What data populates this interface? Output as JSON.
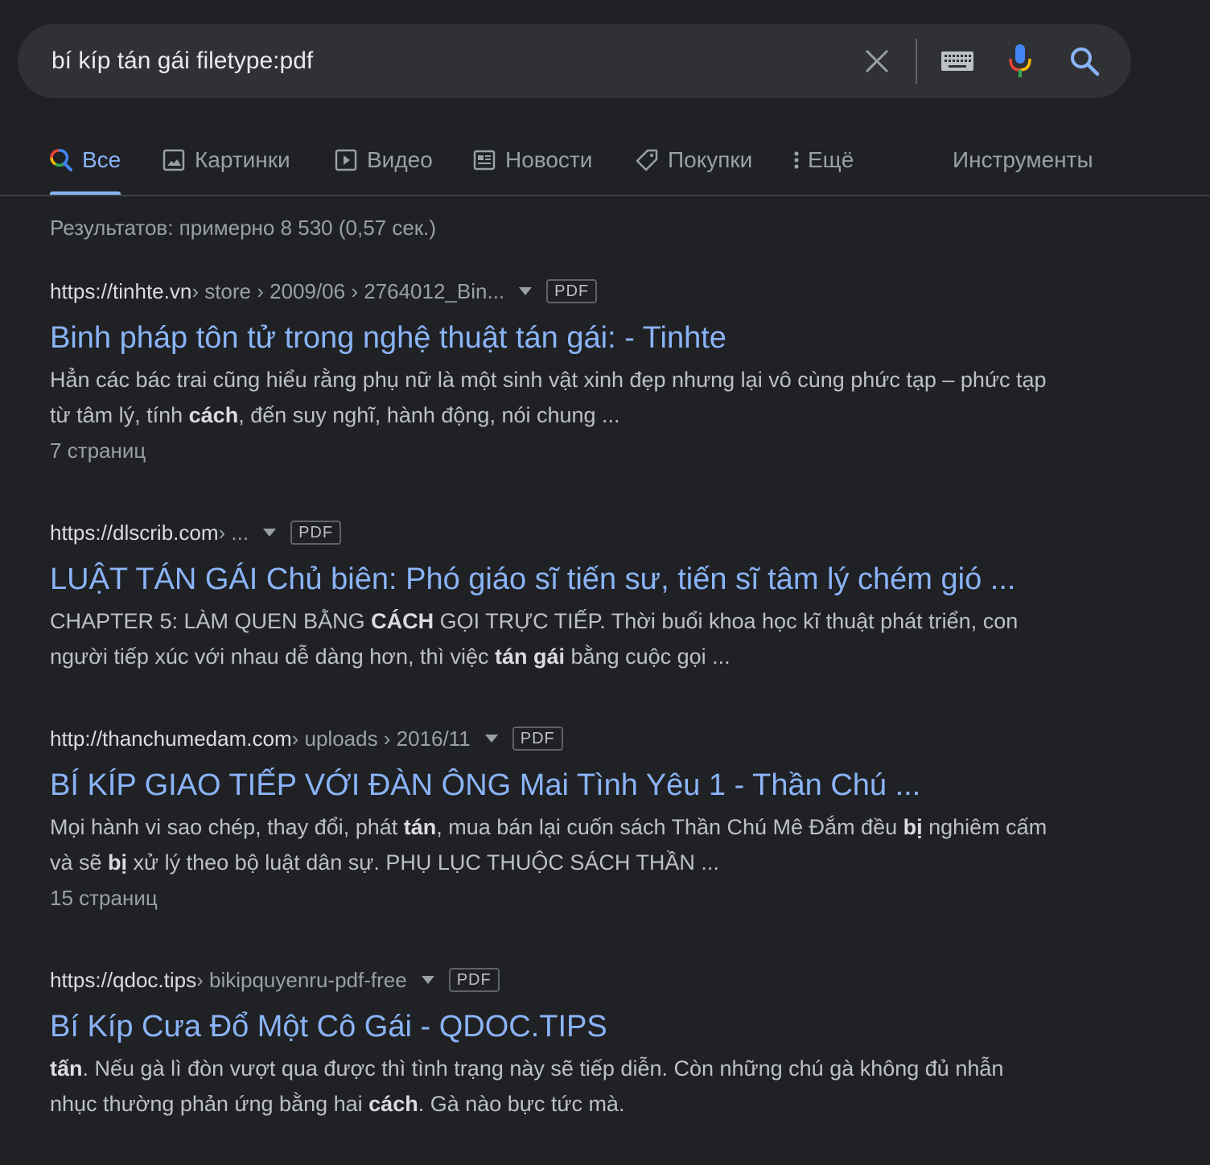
{
  "search": {
    "query": "bí kíp tán gái filetype:pdf",
    "icons": [
      "close-icon",
      "keyboard-icon",
      "mic-icon",
      "search-icon"
    ]
  },
  "tabs": [
    {
      "label": "Все",
      "icon": "google-search-icon",
      "active": true
    },
    {
      "label": "Картинки",
      "icon": "image-icon"
    },
    {
      "label": "Видео",
      "icon": "video-play-icon"
    },
    {
      "label": "Новости",
      "icon": "news-icon"
    },
    {
      "label": "Покупки",
      "icon": "tag-icon"
    },
    {
      "label": "Ещё",
      "icon": "more-vert-icon"
    }
  ],
  "tools_label": "Инструменты",
  "stats": "Результатов: примерно 8 530 (0,57 сек.)",
  "results": [
    {
      "domain": "https://tinhte.vn",
      "path": " › store › 2009/06 › 2764012_Bin...",
      "badge": "PDF",
      "title": "Binh pháp tôn tử trong nghệ thuật tán gái: - Tinhte",
      "snippet_html": "Hẳn các bác trai cũng hiểu rằng phụ nữ là một sinh vật xinh đẹp nhưng lại vô cùng phức tạp – phức tạp từ tâm lý, tính <b>cách</b>, đến suy nghĩ, hành động, nói chung ...",
      "pages": "7 страниц"
    },
    {
      "domain": "https://dlscrib.com",
      "path": " › ...",
      "badge": "PDF",
      "title": "LUẬT TÁN GÁI Chủ biên: Phó giáo sĩ tiến sư, tiến sĩ tâm lý chém gió ...",
      "snippet_html": "CHAPTER 5: LÀM QUEN BẰNG <b>CÁCH</b> GỌI TRỰC TIẾP. Thời buổi khoa học kĩ thuật phát triển, con người tiếp xúc với nhau dễ dàng hơn, thì việc <b>tán gái</b> bằng cuộc gọi ...",
      "pages": ""
    },
    {
      "domain": "http://thanchumedam.com",
      "path": " › uploads › 2016/11",
      "badge": "PDF",
      "title": "BÍ KÍP GIAO TIẾP VỚI ĐÀN ÔNG Mai Tình Yêu 1 - Thần Chú ...",
      "snippet_html": "Mọi hành vi sao chép, thay đổi, phát <b>tán</b>, mua bán lại cuốn sách Thần Chú Mê Đắm đều <b>bị</b> nghiêm cấm và sẽ <b>bị</b> xử lý theo bộ luật dân sự. PHỤ LỤC THUỘC SÁCH THẦN ...",
      "pages": "15 страниц"
    },
    {
      "domain": "https://qdoc.tips",
      "path": " › bikipquyenru-pdf-free",
      "badge": "PDF",
      "title": "Bí Kíp Cưa Đổ Một Cô Gái - QDOC.TIPS",
      "snippet_html": "<b>tấn</b>. Nếu gà lì đòn vượt qua được thì tình trạng này sẽ tiếp diễn. Còn những chú gà không đủ nhẫn nhục thường phản ứng bằng hai <b>cách</b>. Gà nào bực tức mà.",
      "pages": ""
    }
  ],
  "colors": {
    "background": "#202124",
    "searchbar": "#303134",
    "link": "#8ab4f8",
    "text": "#bdc1c6",
    "muted": "#9aa0a6"
  }
}
